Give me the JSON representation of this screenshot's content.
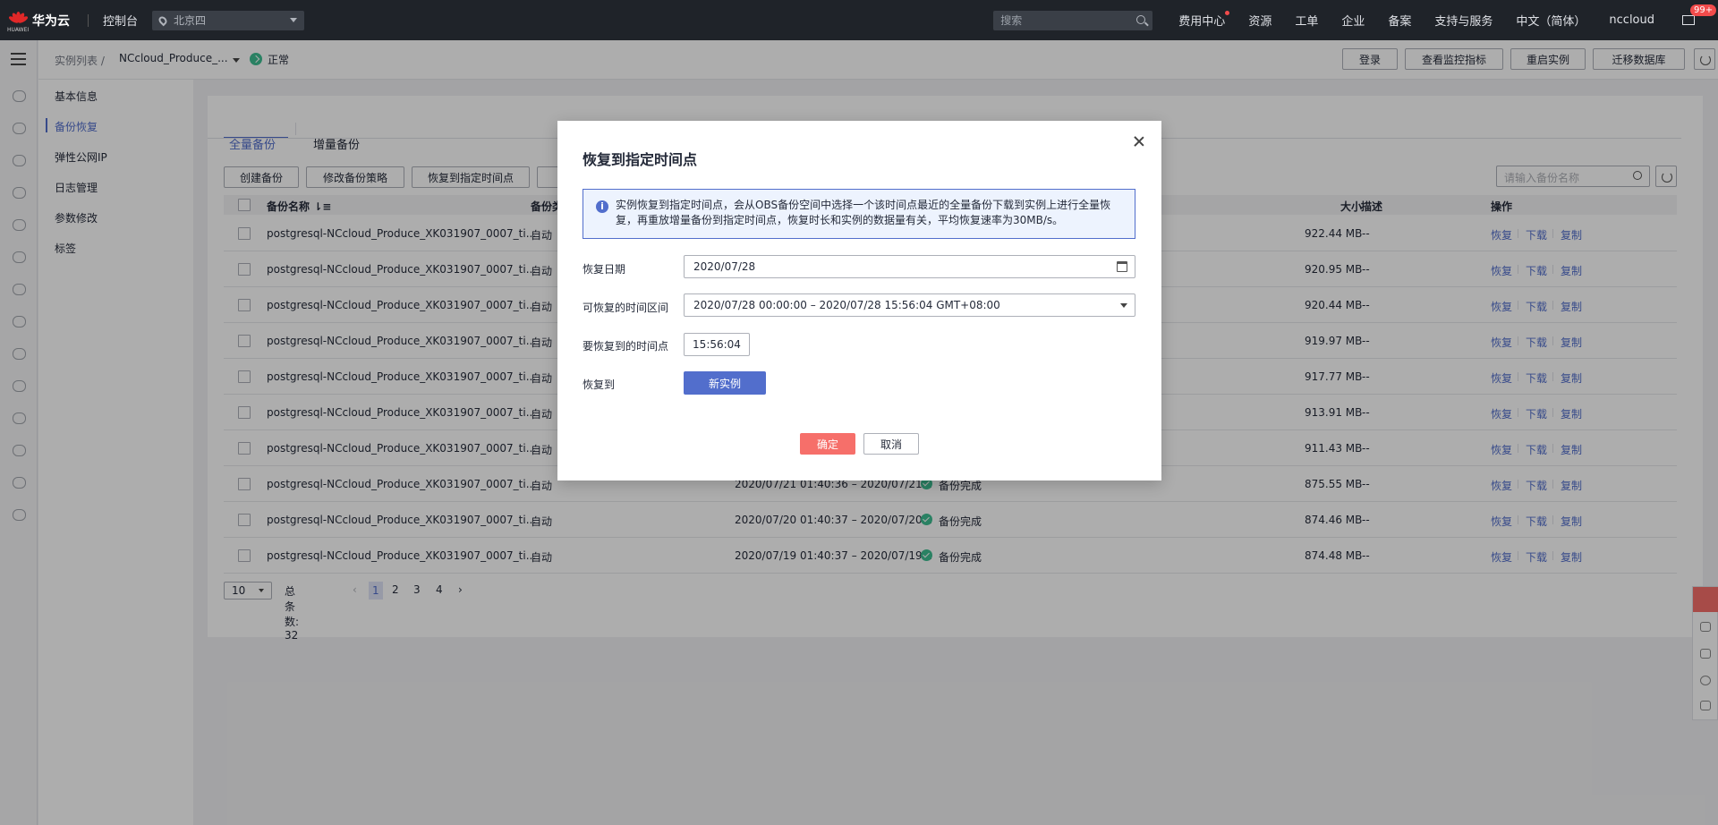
{
  "topbar": {
    "logo_sub": "HUAWEI",
    "brand": "华为云",
    "console": "控制台",
    "region": "北京四",
    "search_placeholder": "搜索",
    "links": [
      "费用中心",
      "资源",
      "工单",
      "企业",
      "备案",
      "支持与服务",
      "中文（简体）",
      "nccloud"
    ],
    "mail_badge": "99+"
  },
  "breadcrumb": {
    "root": "实例列表 /",
    "instance": "NCcloud_Produce_...",
    "status": "正常"
  },
  "header_buttons": [
    "登录",
    "查看监控指标",
    "重启实例",
    "迁移数据库"
  ],
  "sidebar": {
    "items": [
      "基本信息",
      "备份恢复",
      "弹性公网IP",
      "日志管理",
      "参数修改",
      "标签"
    ],
    "active_index": 1
  },
  "tabs": [
    "全量备份",
    "增量备份"
  ],
  "toolbar": {
    "buttons": [
      "创建备份",
      "修改备份策略",
      "恢复到指定时间点"
    ],
    "search_placeholder": "请输入备份名称"
  },
  "table": {
    "headers": [
      "备份名称",
      "备份类",
      "大小",
      "描述",
      "操作"
    ],
    "name_sort_icon": "⇂≡",
    "rows": [
      {
        "name": "postgresql-NCcloud_Produce_XK031907_0007_ti...",
        "type": "自动",
        "time": "",
        "status": "",
        "size": "922.44 MB",
        "desc": "--"
      },
      {
        "name": "postgresql-NCcloud_Produce_XK031907_0007_ti...",
        "type": "自动",
        "time": "",
        "status": "",
        "size": "920.95 MB",
        "desc": "--"
      },
      {
        "name": "postgresql-NCcloud_Produce_XK031907_0007_ti...",
        "type": "自动",
        "time": "",
        "status": "",
        "size": "920.44 MB",
        "desc": "--"
      },
      {
        "name": "postgresql-NCcloud_Produce_XK031907_0007_ti...",
        "type": "自动",
        "time": "",
        "status": "",
        "size": "919.97 MB",
        "desc": "--"
      },
      {
        "name": "postgresql-NCcloud_Produce_XK031907_0007_ti...",
        "type": "自动",
        "time": "",
        "status": "",
        "size": "917.77 MB",
        "desc": "--"
      },
      {
        "name": "postgresql-NCcloud_Produce_XK031907_0007_ti...",
        "type": "自动",
        "time": "",
        "status": "",
        "size": "913.91 MB",
        "desc": "--"
      },
      {
        "name": "postgresql-NCcloud_Produce_XK031907_0007_ti...",
        "type": "自动",
        "time": "",
        "status": "",
        "size": "911.43 MB",
        "desc": "--"
      },
      {
        "name": "postgresql-NCcloud_Produce_XK031907_0007_ti...",
        "type": "自动",
        "time": "2020/07/21 01:40:36 – 2020/07/21...",
        "status": "备份完成",
        "size": "875.55 MB",
        "desc": "--"
      },
      {
        "name": "postgresql-NCcloud_Produce_XK031907_0007_ti...",
        "type": "自动",
        "time": "2020/07/20 01:40:37 – 2020/07/20...",
        "status": "备份完成",
        "size": "874.46 MB",
        "desc": "--"
      },
      {
        "name": "postgresql-NCcloud_Produce_XK031907_0007_ti...",
        "type": "自动",
        "time": "2020/07/19 01:40:37 – 2020/07/19...",
        "status": "备份完成",
        "size": "874.48 MB",
        "desc": "--"
      }
    ],
    "ops": [
      "恢复",
      "下载",
      "复制"
    ]
  },
  "pager": {
    "page_size": "10",
    "total": "总条数: 32",
    "pages": [
      "1",
      "2",
      "3",
      "4"
    ],
    "prev": "‹",
    "next": "›",
    "current": "1"
  },
  "modal": {
    "title": "恢复到指定时间点",
    "info": "实例恢复到指定时间点，会从OBS备份空间中选择一个该时间点最近的全量备份下载到实例上进行全量恢复，再重放增量备份到指定时间点，恢复时长和实例的数据量有关，平均恢复速率为30MB/s。",
    "info_icon": "i",
    "date_label": "恢复日期",
    "date_value": "2020/07/28",
    "range_label": "可恢复的时间区间",
    "range_value": "2020/07/28 00:00:00 – 2020/07/28 15:56:04 GMT+08:00",
    "time_label": "要恢复到的时间点",
    "time_value": "15:56:04",
    "target_label": "恢复到",
    "target_button": "新实例",
    "ok": "确定",
    "cancel": "取消"
  },
  "colors": {
    "accent": "#526ecc",
    "danger": "#f66f6a",
    "success": "#3ebf93",
    "topbar": "#1f2329"
  }
}
